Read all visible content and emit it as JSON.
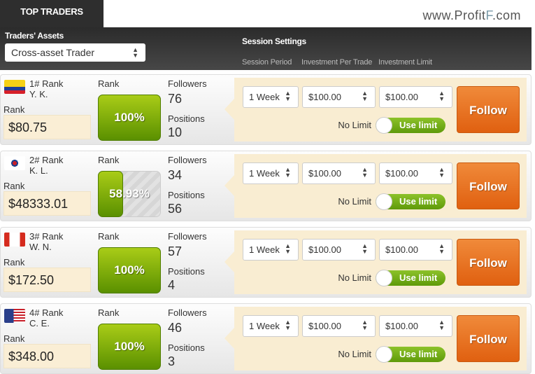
{
  "header": {
    "tab": "TOP TRADERS",
    "brand_prefix": "www.Profit",
    "brand_mark": "F",
    "brand_suffix": ".com"
  },
  "toolbar": {
    "assets_label": "Traders' Assets",
    "assets_value": "Cross-asset Trader",
    "session_settings": "Session Settings",
    "col_period": "Session Period",
    "col_investment": "Investment Per Trade",
    "col_limit": "Investment Limit"
  },
  "labels": {
    "rank": "Rank",
    "followers": "Followers",
    "positions": "Positions",
    "no_limit": "No Limit",
    "use_limit": "Use limit",
    "follow": "Follow"
  },
  "traders": [
    {
      "rank": "1# Rank",
      "name": "Y. K.",
      "country": "Colombia",
      "value": "$80.75",
      "pct_label": "100%",
      "pct": 100,
      "followers": "76",
      "positions": "10",
      "period": "1 Week",
      "investment": "$100.00",
      "limit": "$100.00"
    },
    {
      "rank": "2# Rank",
      "name": "K. L.",
      "country": "South Korea",
      "value": "$48333.01",
      "pct_label": "58.93%",
      "pct": 58.93,
      "followers": "34",
      "positions": "56",
      "period": "1 Week",
      "investment": "$100.00",
      "limit": "$100.00"
    },
    {
      "rank": "3# Rank",
      "name": "W. N.",
      "country": "Canada",
      "value": "$172.50",
      "pct_label": "100%",
      "pct": 100,
      "followers": "57",
      "positions": "4",
      "period": "1 Week",
      "investment": "$100.00",
      "limit": "$100.00"
    },
    {
      "rank": "4# Rank",
      "name": "C. E.",
      "country": "USA",
      "value": "$348.00",
      "pct_label": "100%",
      "pct": 100,
      "followers": "46",
      "positions": "3",
      "period": "1 Week",
      "investment": "$100.00",
      "limit": "$100.00"
    }
  ]
}
